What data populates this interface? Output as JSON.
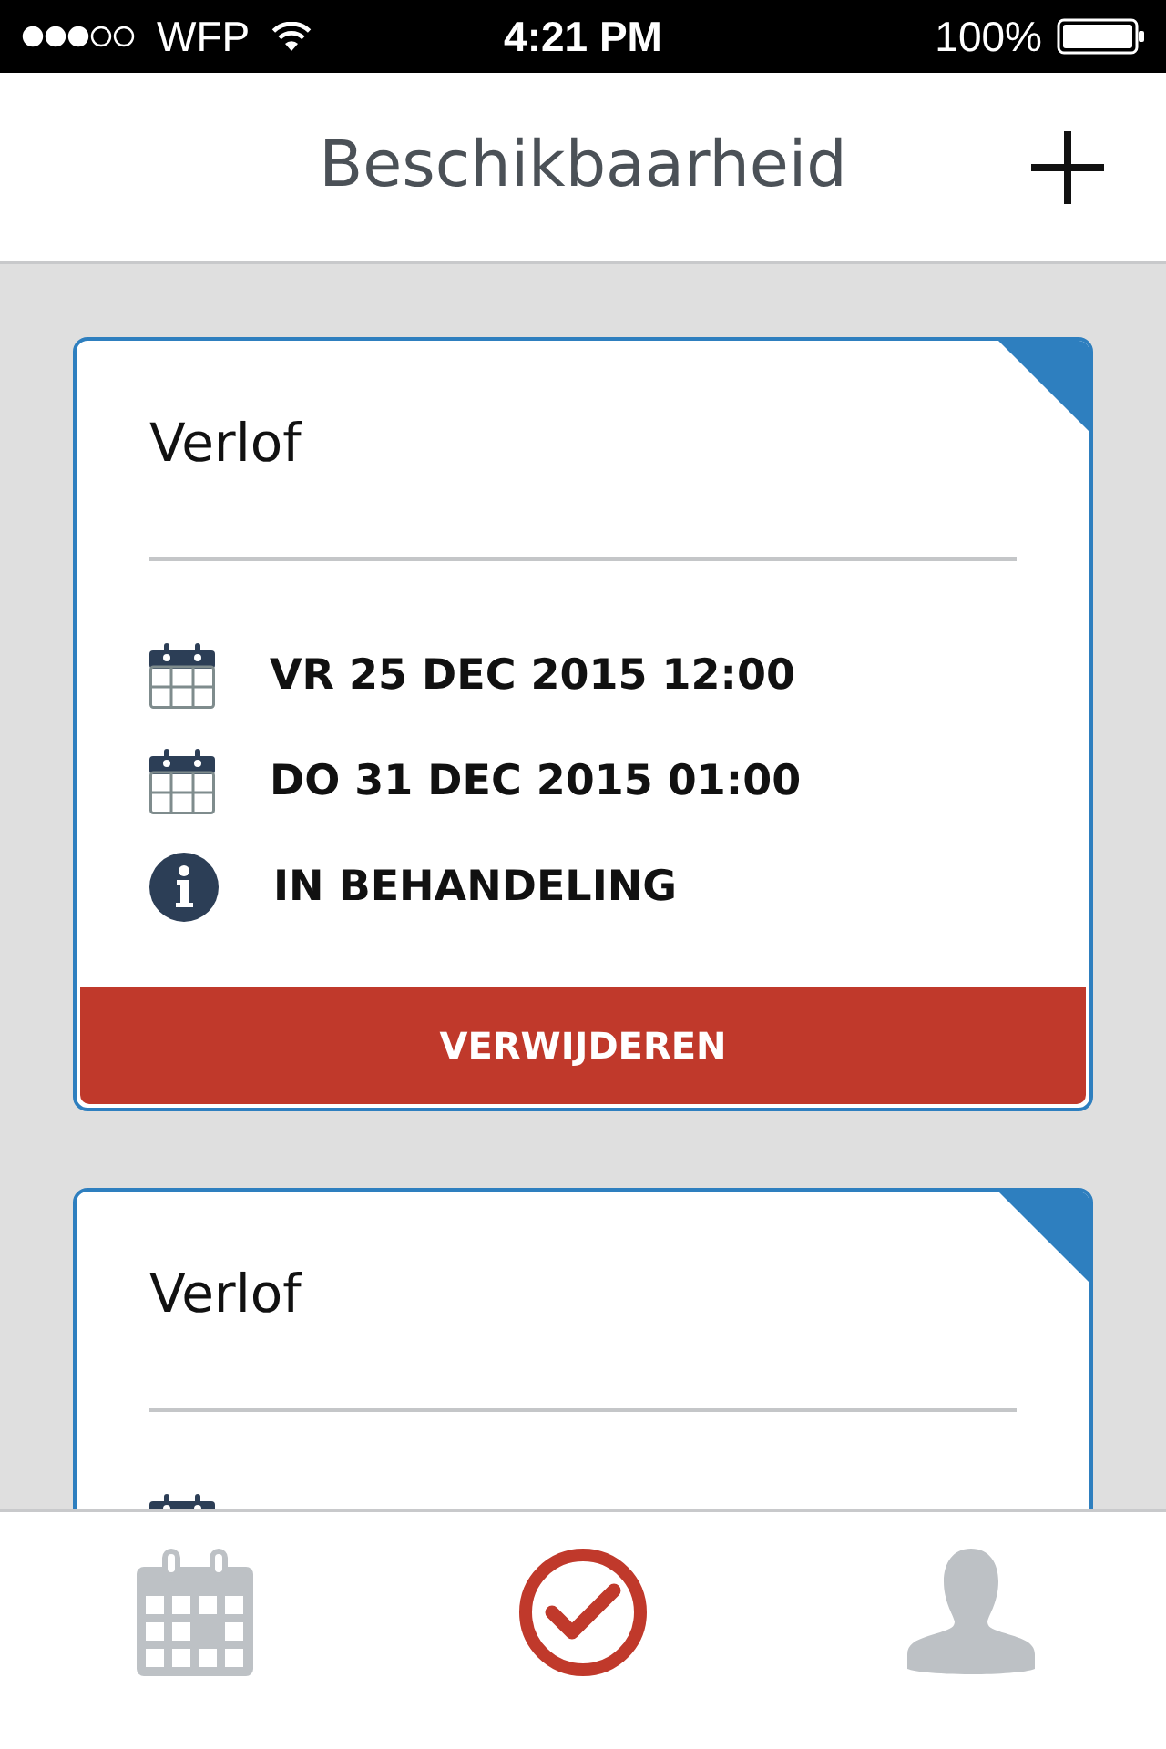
{
  "status_bar": {
    "carrier": "WFP",
    "time": "4:21 PM",
    "battery": "100%"
  },
  "header": {
    "title": "Beschikbaarheid"
  },
  "cards": [
    {
      "title": "Verlof",
      "details": [
        {
          "kind": "date",
          "text": "VR 25 DEC 2015 12:00"
        },
        {
          "kind": "date",
          "text": "DO 31 DEC 2015 01:00"
        },
        {
          "kind": "status",
          "text": "IN BEHANDELING"
        }
      ],
      "action": "VERWIJDEREN"
    },
    {
      "title": "Verlof",
      "details": [
        {
          "kind": "date"
        }
      ]
    }
  ],
  "tab_bar": [
    {
      "kind": "calendar",
      "selected": false
    },
    {
      "kind": "check",
      "selected": true
    },
    {
      "kind": "profile",
      "selected": false
    }
  ]
}
